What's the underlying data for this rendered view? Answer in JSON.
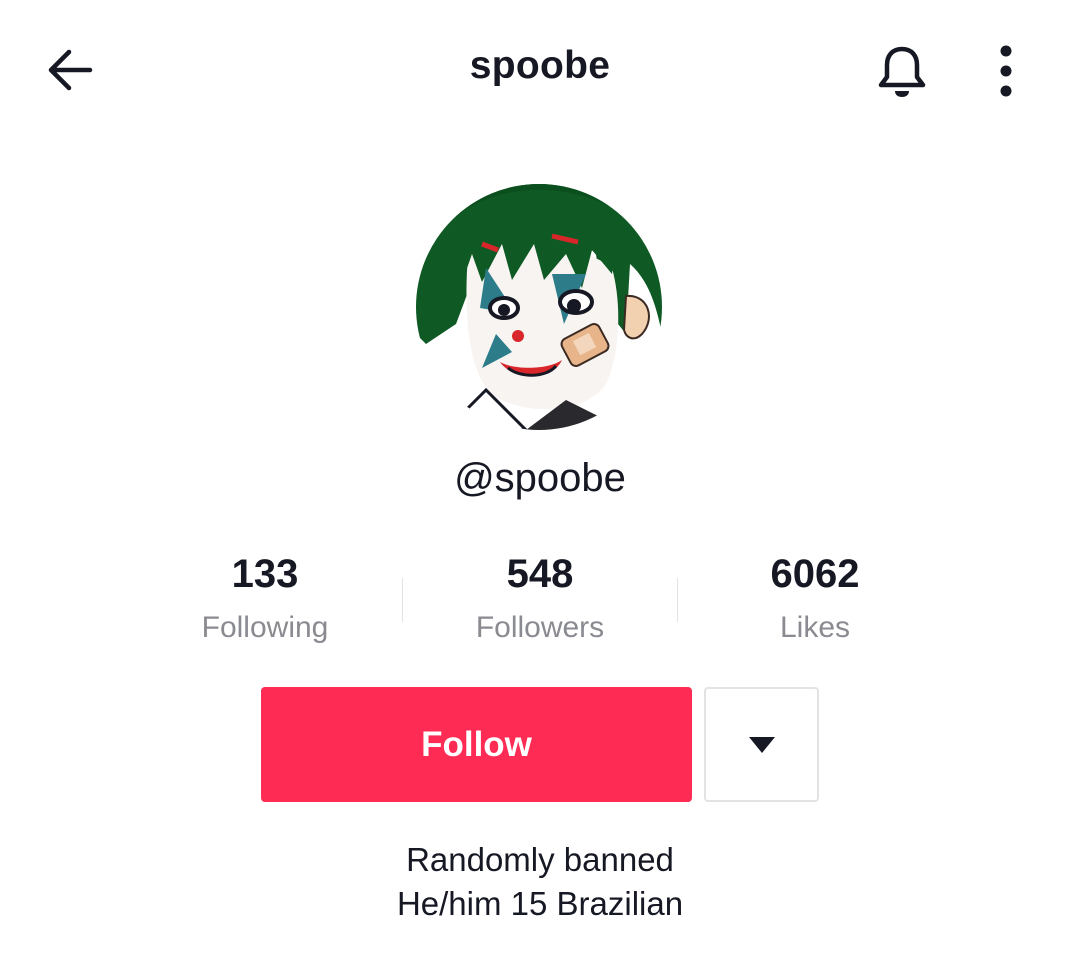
{
  "header": {
    "title": "spoobe",
    "back_icon": "arrow-left-icon",
    "bell_icon": "bell-icon",
    "more_icon": "more-vertical-icon"
  },
  "profile": {
    "avatar_icon": "avatar-image",
    "handle": "@spoobe"
  },
  "stats": [
    {
      "value": "133",
      "label": "Following"
    },
    {
      "value": "548",
      "label": "Followers"
    },
    {
      "value": "6062",
      "label": "Likes"
    }
  ],
  "actions": {
    "follow_label": "Follow",
    "dropdown_icon": "caret-down-icon"
  },
  "bio": {
    "line1": "Randomly banned",
    "line2": "He/him 15 Brazilian"
  },
  "colors": {
    "accent": "#fe2c55",
    "text": "#161823",
    "muted": "#8a8b91",
    "border": "#e3e3e4"
  }
}
